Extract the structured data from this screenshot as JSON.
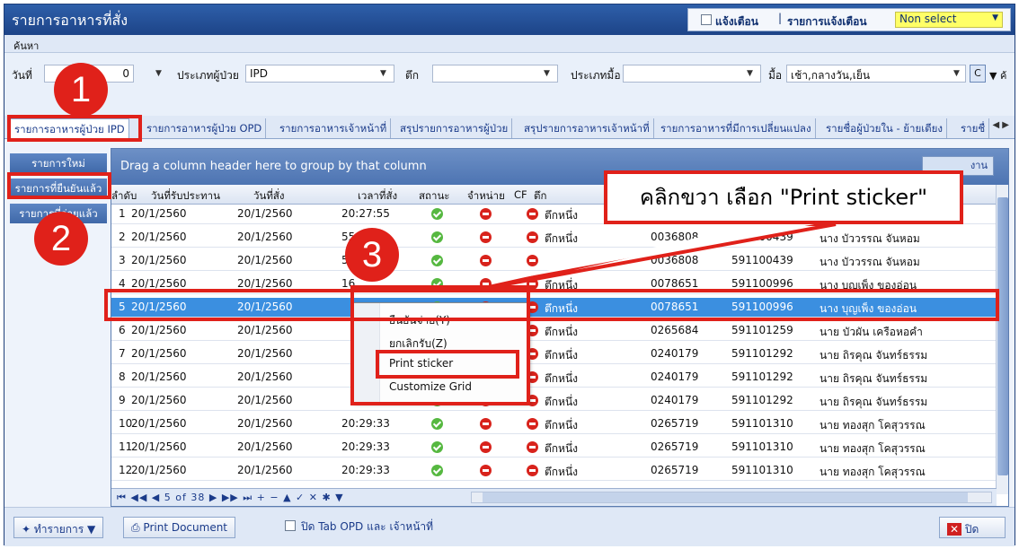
{
  "window": {
    "title": "รายการอาหารที่สั่ง"
  },
  "alert": {
    "checkbox_label": "แจ้งเตือน",
    "list_label": "รายการแจ้งเตือน",
    "list_value": "Non select"
  },
  "menu": {
    "search_label": "ค้นหา"
  },
  "filters": {
    "date_label": "วันที่",
    "date_value": "0",
    "patient_type_label": "ประเภทผู้ป่วย",
    "patient_type_value": "IPD",
    "building_label": "ตึก",
    "building_value": "",
    "meal_type_label": "ประเภทมื้อ",
    "meal_type_value": "",
    "meal_label": "มื้อ",
    "meal_value": "เช้า,กลางวัน,เย็น",
    "c_button": "C",
    "more_label": "ค้"
  },
  "tabs": [
    "รายการอาหารผู้ป่วย IPD",
    "รายการอาหารผู้ป่วย OPD",
    "รายการอาหารเจ้าหน้าที่",
    "สรุปรายการอาหารผู้ป่วย",
    "สรุปรายการอาหารเจ้าหน้าที่",
    "รายการอาหารที่มีการเปลี่ยนแปลง",
    "รายชื่อผู้ป่วยใน - ย้ายเตียง",
    "รายชื่"
  ],
  "sidebar": {
    "items": [
      "รายการใหม่",
      "รายการที่ยืนยันแล้ว",
      "รายการที่จ่ายแล้ว"
    ]
  },
  "grid": {
    "group_hint": "Drag a column header here to group by that column",
    "group_button": "งาน",
    "columns": [
      "ลำดับ",
      "วันที่รับประทาน",
      "วันที่สั่ง",
      "เวลาที่สั่ง",
      "สถานะ",
      "จำหน่าย",
      "CF",
      "ตึก"
    ],
    "rows": [
      {
        "no": "1",
        "eat_date": "20/1/2560",
        "order_date": "20/1/2560",
        "time": "20:27:55",
        "ward": "ตึกหนึ่ง",
        "hn": "",
        "an": "",
        "name": ""
      },
      {
        "no": "2",
        "eat_date": "20/1/2560",
        "order_date": "20/1/2560",
        "time": "55",
        "ward": "ตึกหนึ่ง",
        "hn": "0036808",
        "an": "591100439",
        "name": "นาง บัววรรณ จันหอม"
      },
      {
        "no": "3",
        "eat_date": "20/1/2560",
        "order_date": "20/1/2560",
        "time": "55",
        "ward": "",
        "hn": "0036808",
        "an": "591100439",
        "name": "นาง บัววรรณ จันหอม"
      },
      {
        "no": "4",
        "eat_date": "20/1/2560",
        "order_date": "20/1/2560",
        "time": "16",
        "ward": "ตึกหนึ่ง",
        "hn": "0078651",
        "an": "591100996",
        "name": "นาง บุญเพ็ง ของอ่อน"
      },
      {
        "no": "5",
        "eat_date": "20/1/2560",
        "order_date": "20/1/2560",
        "time": "",
        "ward": "ตึกหนึ่ง",
        "hn": "0078651",
        "an": "591100996",
        "name": "นาง บุญเพ็ง ของอ่อน"
      },
      {
        "no": "6",
        "eat_date": "20/1/2560",
        "order_date": "20/1/2560",
        "time": "",
        "ward": "ตึกหนึ่ง",
        "hn": "0265684",
        "an": "591101259",
        "name": "นาย บัวผัน เครือหอคำ"
      },
      {
        "no": "7",
        "eat_date": "20/1/2560",
        "order_date": "20/1/2560",
        "time": "",
        "ward": "ตึกหนึ่ง",
        "hn": "0240179",
        "an": "591101292",
        "name": "นาย ถิรคุณ จันทร์ธรรม"
      },
      {
        "no": "8",
        "eat_date": "20/1/2560",
        "order_date": "20/1/2560",
        "time": "",
        "ward": "ตึกหนึ่ง",
        "hn": "0240179",
        "an": "591101292",
        "name": "นาย ถิรคุณ จันทร์ธรรม"
      },
      {
        "no": "9",
        "eat_date": "20/1/2560",
        "order_date": "20/1/2560",
        "time": "",
        "ward": "ตึกหนึ่ง",
        "hn": "0240179",
        "an": "591101292",
        "name": "นาย ถิรคุณ จันทร์ธรรม"
      },
      {
        "no": "10",
        "eat_date": "20/1/2560",
        "order_date": "20/1/2560",
        "time": "20:29:33",
        "ward": "ตึกหนึ่ง",
        "hn": "0265719",
        "an": "591101310",
        "name": "นาย ทองสุก โคสุวรรณ"
      },
      {
        "no": "11",
        "eat_date": "20/1/2560",
        "order_date": "20/1/2560",
        "time": "20:29:33",
        "ward": "ตึกหนึ่ง",
        "hn": "0265719",
        "an": "591101310",
        "name": "นาย ทองสุก โคสุวรรณ"
      },
      {
        "no": "12",
        "eat_date": "20/1/2560",
        "order_date": "20/1/2560",
        "time": "20:29:33",
        "ward": "ตึกหนึ่ง",
        "hn": "0265719",
        "an": "591101310",
        "name": "นาย ทองสุก โคสุวรรณ"
      }
    ],
    "navigator": "5 of 38"
  },
  "context_menu": {
    "items": [
      "ยืนยันจ่าย(Y)",
      "ยกเลิกรับ(Z)",
      "Print sticker",
      "Customize Grid"
    ]
  },
  "bottom": {
    "action_label": "ทำรายการ",
    "print_label": "Print Document",
    "close_tab_label": "ปิด Tab OPD และ เจ้าหน้าที่",
    "close_label": "ปิด"
  },
  "annotations": {
    "step1": "1",
    "step2": "2",
    "step3": "3",
    "callout": "คลิกขวา เลือก \"Print sticker\""
  },
  "colors": {
    "title_bar": "#1d4488",
    "selected_row": "#3b8fe0",
    "annotation_red": "#e0211a",
    "highlight_yellow": "#ffff66"
  }
}
